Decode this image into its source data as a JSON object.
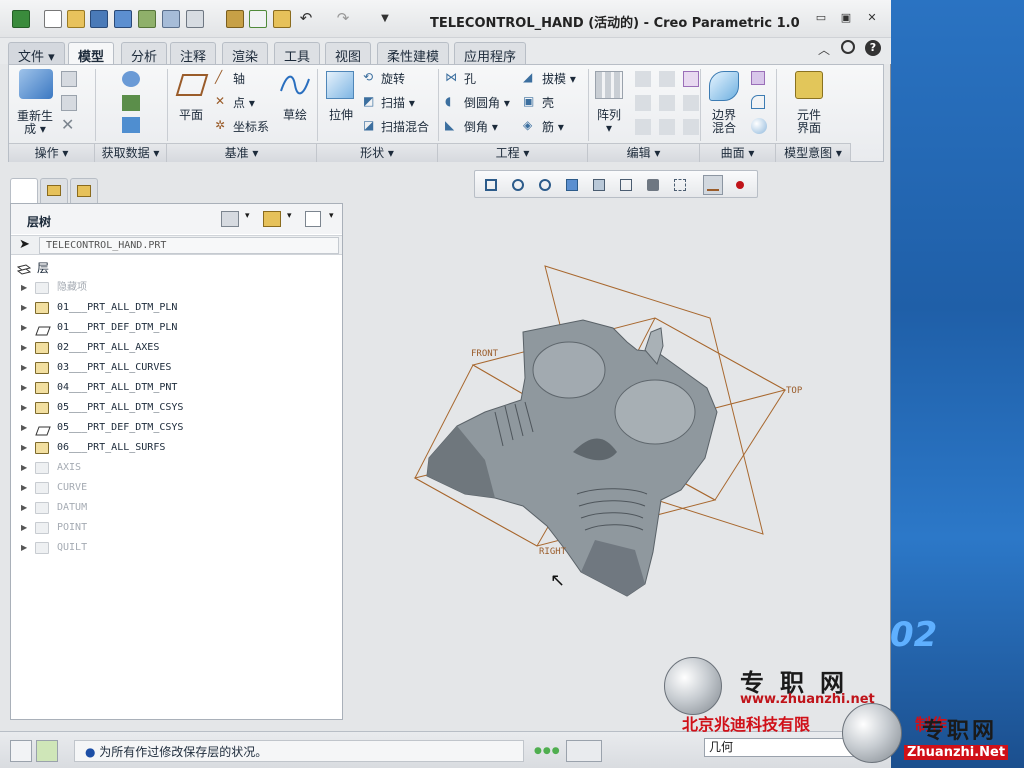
{
  "window": {
    "title": "TELECONTROL_HAND (活动的) - Creo Parametric 1.0",
    "controls": {
      "minimize": "▭",
      "maximize": "▣",
      "close": "✕"
    }
  },
  "tabs": [
    {
      "label": "文件 ▾",
      "kind": "file"
    },
    {
      "label": "模型",
      "kind": "active"
    },
    {
      "label": "分析"
    },
    {
      "label": "注释"
    },
    {
      "label": "渲染"
    },
    {
      "label": "工具"
    },
    {
      "label": "视图"
    },
    {
      "label": "柔性建模"
    },
    {
      "label": "应用程序"
    }
  ],
  "ribbon": {
    "regenerate": "重新生\n成 ▾",
    "plane": "平面",
    "axis": "轴",
    "point": "点 ▾",
    "csys": "坐标系",
    "sketch": "草绘",
    "extrude": "拉伸",
    "revolve": "旋转",
    "sweep": "扫描 ▾",
    "swept_blend": "扫描混合",
    "hole": "孔",
    "round": "倒圆角 ▾",
    "chamfer": "倒角 ▾",
    "draft": "拔模 ▾",
    "shell": "壳",
    "rib": "筋 ▾",
    "pattern": "阵列\n▾",
    "boundary_blend": "边界\n混合",
    "component_interface": "元件\n界面",
    "groups": [
      {
        "label": "操作 ▾"
      },
      {
        "label": "获取数据 ▾"
      },
      {
        "label": "基准 ▾"
      },
      {
        "label": "形状 ▾"
      },
      {
        "label": "工程 ▾"
      },
      {
        "label": "编辑 ▾"
      },
      {
        "label": "曲面 ▾"
      },
      {
        "label": "模型意图 ▾"
      }
    ]
  },
  "panel": {
    "title": "层树",
    "model": "TELECONTROL_HAND.PRT",
    "root": "层",
    "layers": [
      {
        "label": "隐藏项",
        "dim": true,
        "icon": "layer"
      },
      {
        "label": "01___PRT_ALL_DTM_PLN",
        "dim": false,
        "icon": "layer"
      },
      {
        "label": "01___PRT_DEF_DTM_PLN",
        "dim": false,
        "icon": "plane"
      },
      {
        "label": "02___PRT_ALL_AXES",
        "dim": false,
        "icon": "layer"
      },
      {
        "label": "03___PRT_ALL_CURVES",
        "dim": false,
        "icon": "layer"
      },
      {
        "label": "04___PRT_ALL_DTM_PNT",
        "dim": false,
        "icon": "layer"
      },
      {
        "label": "05___PRT_ALL_DTM_CSYS",
        "dim": false,
        "icon": "layer"
      },
      {
        "label": "05___PRT_DEF_DTM_CSYS",
        "dim": false,
        "icon": "plane"
      },
      {
        "label": "06___PRT_ALL_SURFS",
        "dim": false,
        "icon": "layer"
      },
      {
        "label": "AXIS",
        "dim": true,
        "icon": "layer"
      },
      {
        "label": "CURVE",
        "dim": true,
        "icon": "layer"
      },
      {
        "label": "DATUM",
        "dim": true,
        "icon": "layer"
      },
      {
        "label": "POINT",
        "dim": true,
        "icon": "layer"
      },
      {
        "label": "QUILT",
        "dim": true,
        "icon": "layer"
      }
    ]
  },
  "datum_labels": {
    "front": "FRONT",
    "top": "TOP",
    "right": "RIGHT"
  },
  "status": {
    "message": "为所有作过修改保存层的状况。",
    "filter": "几何"
  },
  "watermark": {
    "name_cn": "专职网",
    "url": "www.zhuanzhi.net",
    "company": "北京兆迪科技有限",
    "make": "制作",
    "name_cn2": "专职网",
    "url2": "Zhuanzhi.Net"
  },
  "desktop_text": "02",
  "colors": {
    "accent": "#1d5fa6",
    "datum": "#a8682f",
    "model": "#8d969c"
  }
}
